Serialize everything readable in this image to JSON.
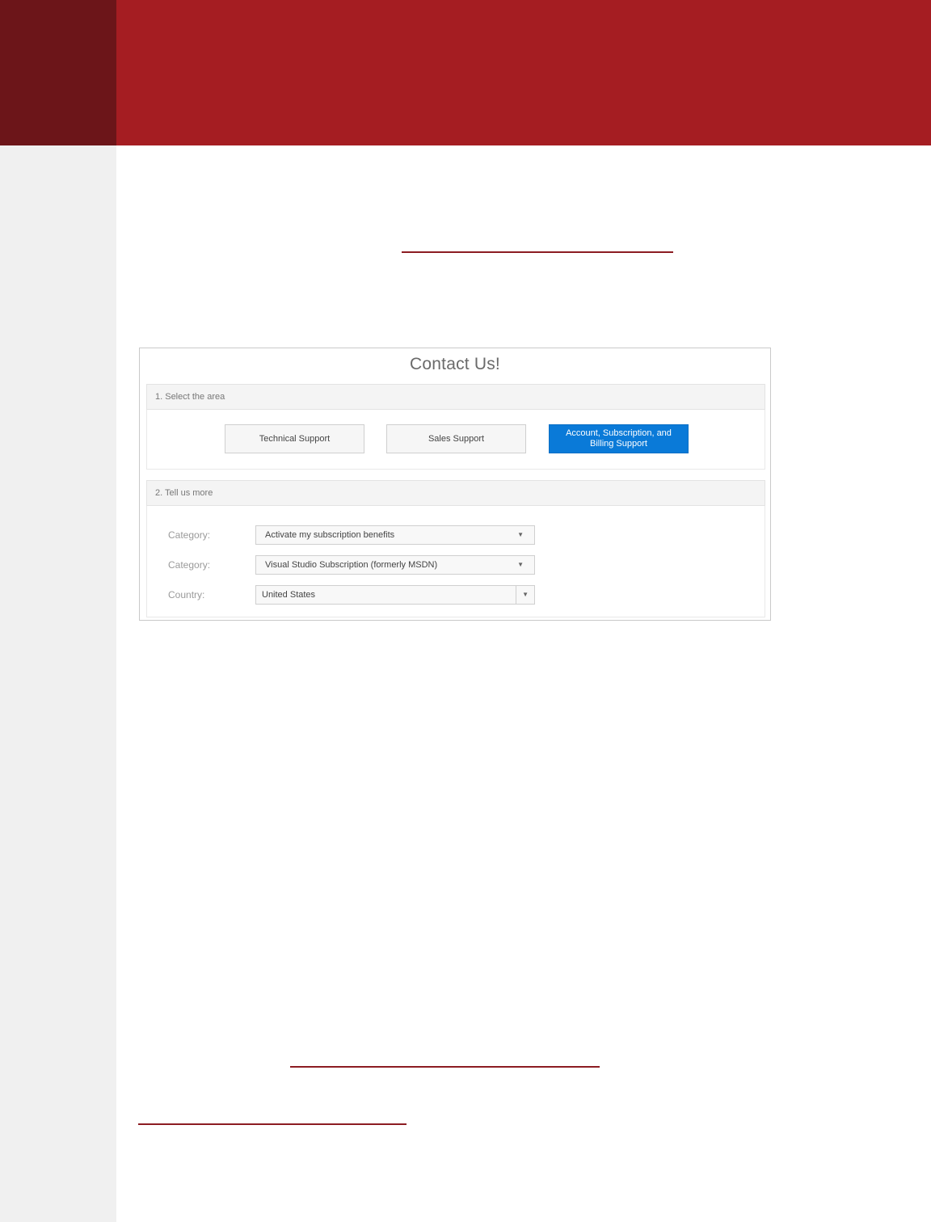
{
  "colors": {
    "banner_dark": "#6c1519",
    "banner_main": "#a51d22",
    "link_rule": "#8c1c22",
    "selected_button": "#0a7ad8"
  },
  "contact_form": {
    "title": "Contact Us!",
    "section1": {
      "heading": "1. Select the area",
      "buttons": {
        "technical": "Technical Support",
        "sales": "Sales Support",
        "account": "Account, Subscription, and Billing Support"
      },
      "selected": "Account, Subscription, and Billing Support"
    },
    "section2": {
      "heading": "2. Tell us more",
      "fields": [
        {
          "label": "Category:",
          "value": "Activate my subscription benefits",
          "icon": "chevron-down-icon"
        },
        {
          "label": "Category:",
          "value": "Visual Studio Subscription (formerly MSDN)",
          "icon": "chevron-down-icon"
        },
        {
          "label": "Country:",
          "value": "United States",
          "icon": "chevron-down-icon"
        }
      ]
    }
  }
}
